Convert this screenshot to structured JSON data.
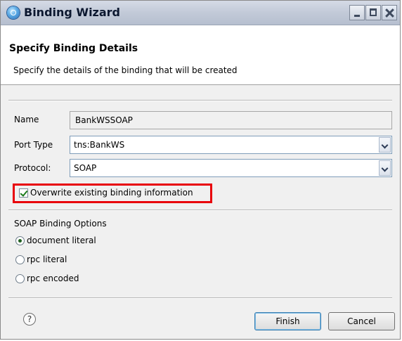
{
  "window": {
    "title": "Binding Wizard"
  },
  "header": {
    "title": "Specify Binding Details",
    "description": "Specify the details of the binding that will be created"
  },
  "form": {
    "name_label": "Name",
    "name_value": "BankWSSOAP",
    "port_type_label": "Port Type",
    "port_type_value": "tns:BankWS",
    "protocol_label": "Protocol:",
    "protocol_value": "SOAP",
    "overwrite_label": "Overwrite existing binding information",
    "overwrite_checked": true
  },
  "soap_options": {
    "group_label": "SOAP Binding Options",
    "options": [
      {
        "label": "document literal",
        "selected": true
      },
      {
        "label": "rpc literal",
        "selected": false
      },
      {
        "label": "rpc encoded",
        "selected": false
      }
    ]
  },
  "footer": {
    "help_icon": "?",
    "finish_label": "Finish",
    "cancel_label": "Cancel"
  },
  "colors": {
    "highlight": "#e8000b",
    "titlebar": "#c2cad8"
  }
}
